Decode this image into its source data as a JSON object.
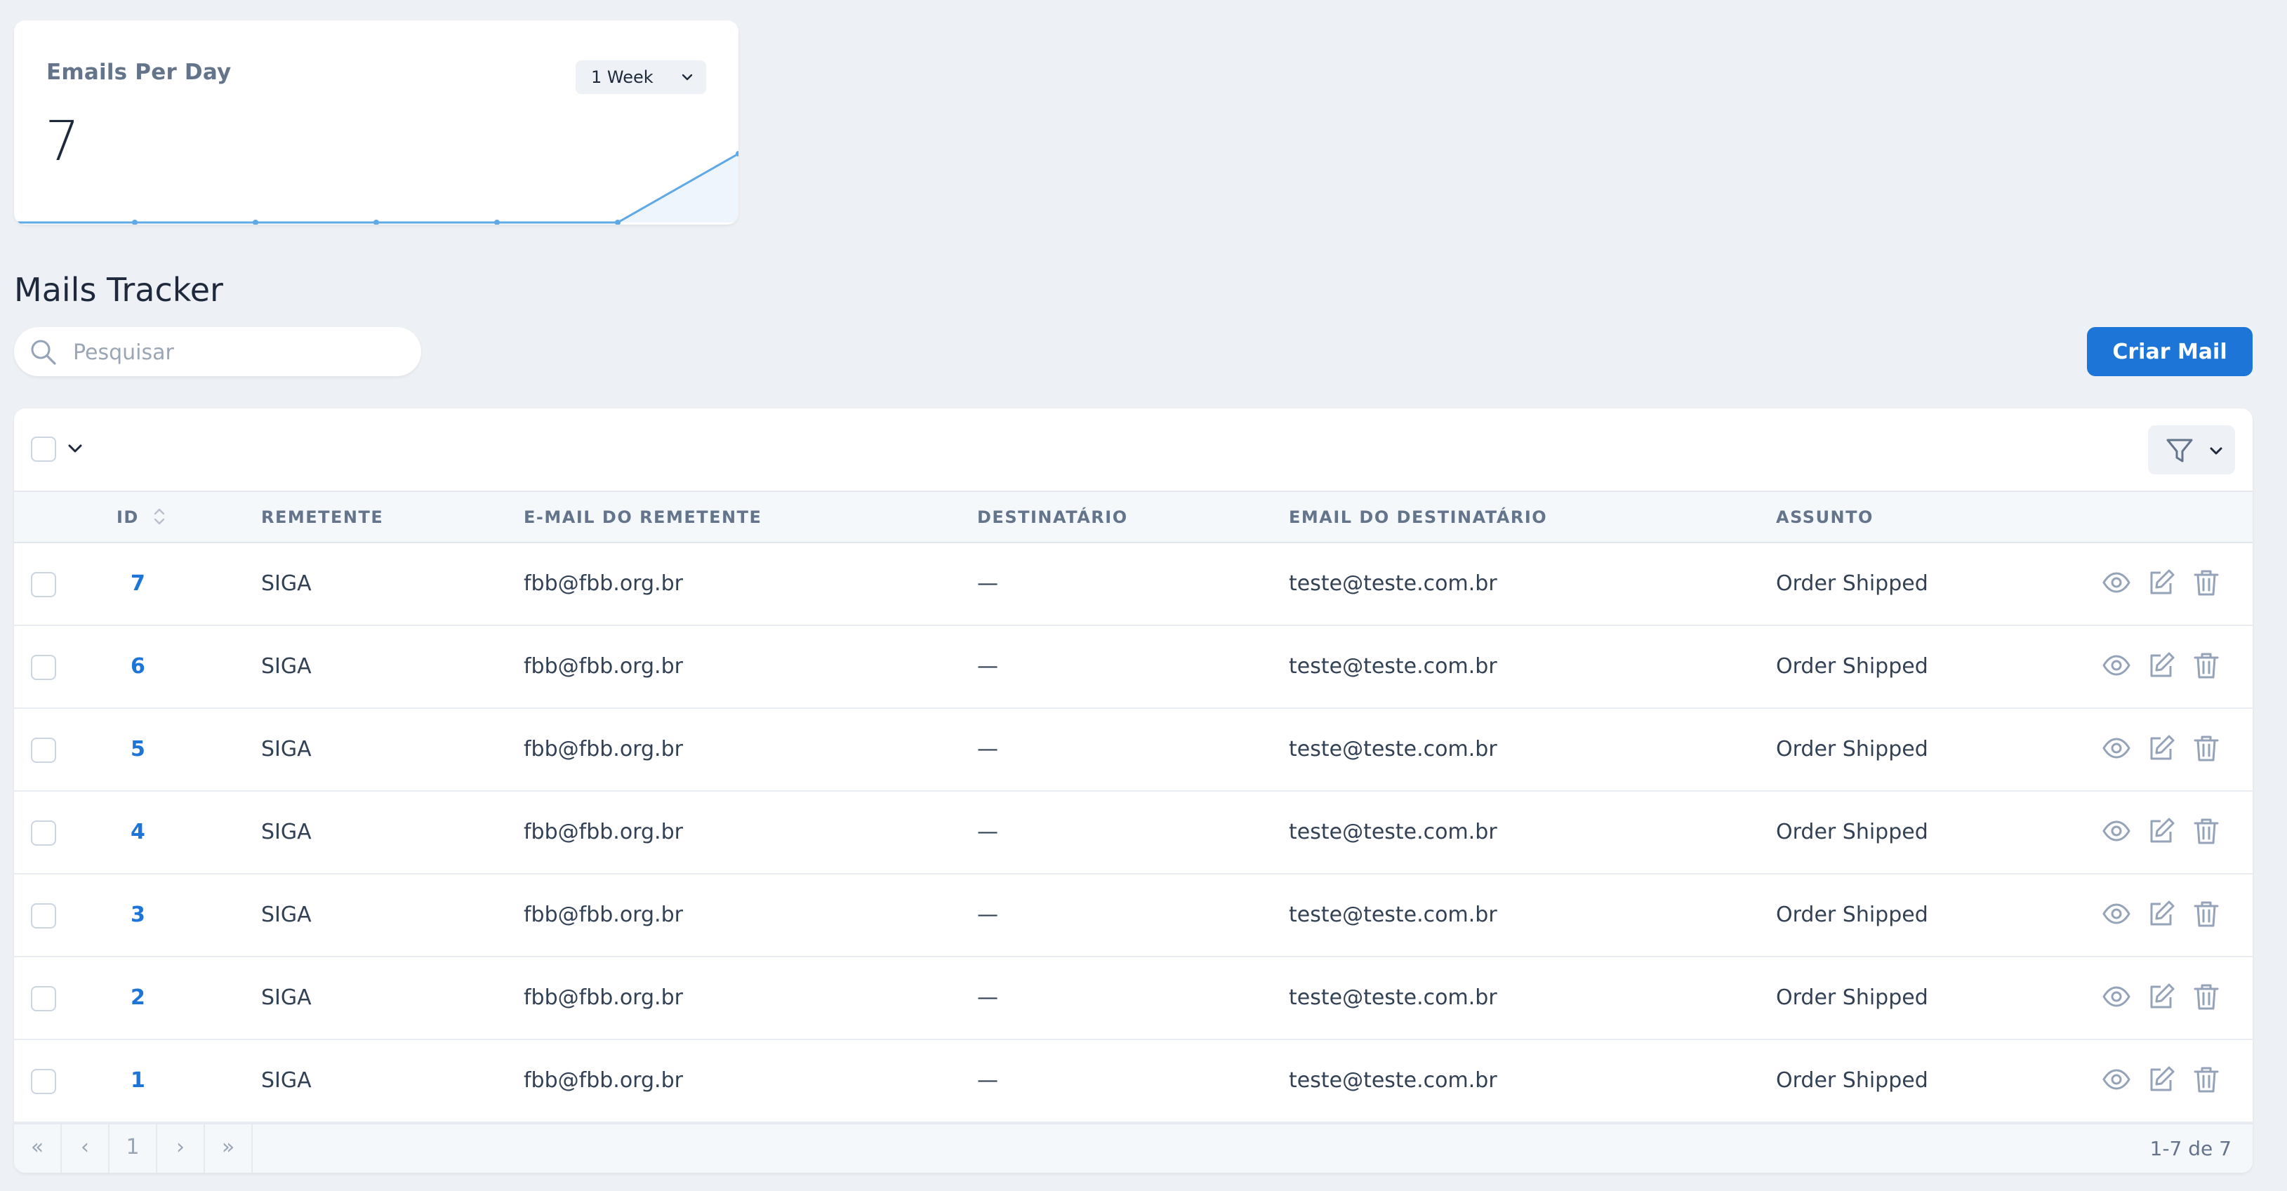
{
  "metric": {
    "title": "Emails Per Day",
    "range": "1 Week",
    "value": "7",
    "trend": [
      0,
      0,
      0,
      0,
      0,
      0,
      7
    ]
  },
  "page": {
    "title": "Mails Tracker"
  },
  "search": {
    "placeholder": "Pesquisar",
    "value": ""
  },
  "create_button": "Criar Mail",
  "colors": {
    "accent": "#1d75d8",
    "background": "#edf0f4",
    "sparkline": "#5ea9e6"
  },
  "icons": {
    "search": "search-icon",
    "filter": "filter-icon",
    "view": "eye-icon",
    "edit": "edit-icon",
    "delete": "trash-icon",
    "sort": "sort-icon"
  },
  "table": {
    "columns": [
      "ID",
      "REMETENTE",
      "E-MAIL DO REMETENTE",
      "DESTINATÁRIO",
      "EMAIL DO DESTINATÁRIO",
      "ASSUNTO"
    ],
    "rows": [
      {
        "id": "7",
        "sender": "SIGA",
        "sender_email": "fbb@fbb.org.br",
        "recipient": "—",
        "recipient_email": "teste@teste.com.br",
        "subject": "Order Shipped"
      },
      {
        "id": "6",
        "sender": "SIGA",
        "sender_email": "fbb@fbb.org.br",
        "recipient": "—",
        "recipient_email": "teste@teste.com.br",
        "subject": "Order Shipped"
      },
      {
        "id": "5",
        "sender": "SIGA",
        "sender_email": "fbb@fbb.org.br",
        "recipient": "—",
        "recipient_email": "teste@teste.com.br",
        "subject": "Order Shipped"
      },
      {
        "id": "4",
        "sender": "SIGA",
        "sender_email": "fbb@fbb.org.br",
        "recipient": "—",
        "recipient_email": "teste@teste.com.br",
        "subject": "Order Shipped"
      },
      {
        "id": "3",
        "sender": "SIGA",
        "sender_email": "fbb@fbb.org.br",
        "recipient": "—",
        "recipient_email": "teste@teste.com.br",
        "subject": "Order Shipped"
      },
      {
        "id": "2",
        "sender": "SIGA",
        "sender_email": "fbb@fbb.org.br",
        "recipient": "—",
        "recipient_email": "teste@teste.com.br",
        "subject": "Order Shipped"
      },
      {
        "id": "1",
        "sender": "SIGA",
        "sender_email": "fbb@fbb.org.br",
        "recipient": "—",
        "recipient_email": "teste@teste.com.br",
        "subject": "Order Shipped"
      }
    ]
  },
  "pagination": {
    "first": "«",
    "prev": "‹",
    "current": "1",
    "next": "›",
    "last": "»",
    "summary": "1-7 de 7"
  }
}
